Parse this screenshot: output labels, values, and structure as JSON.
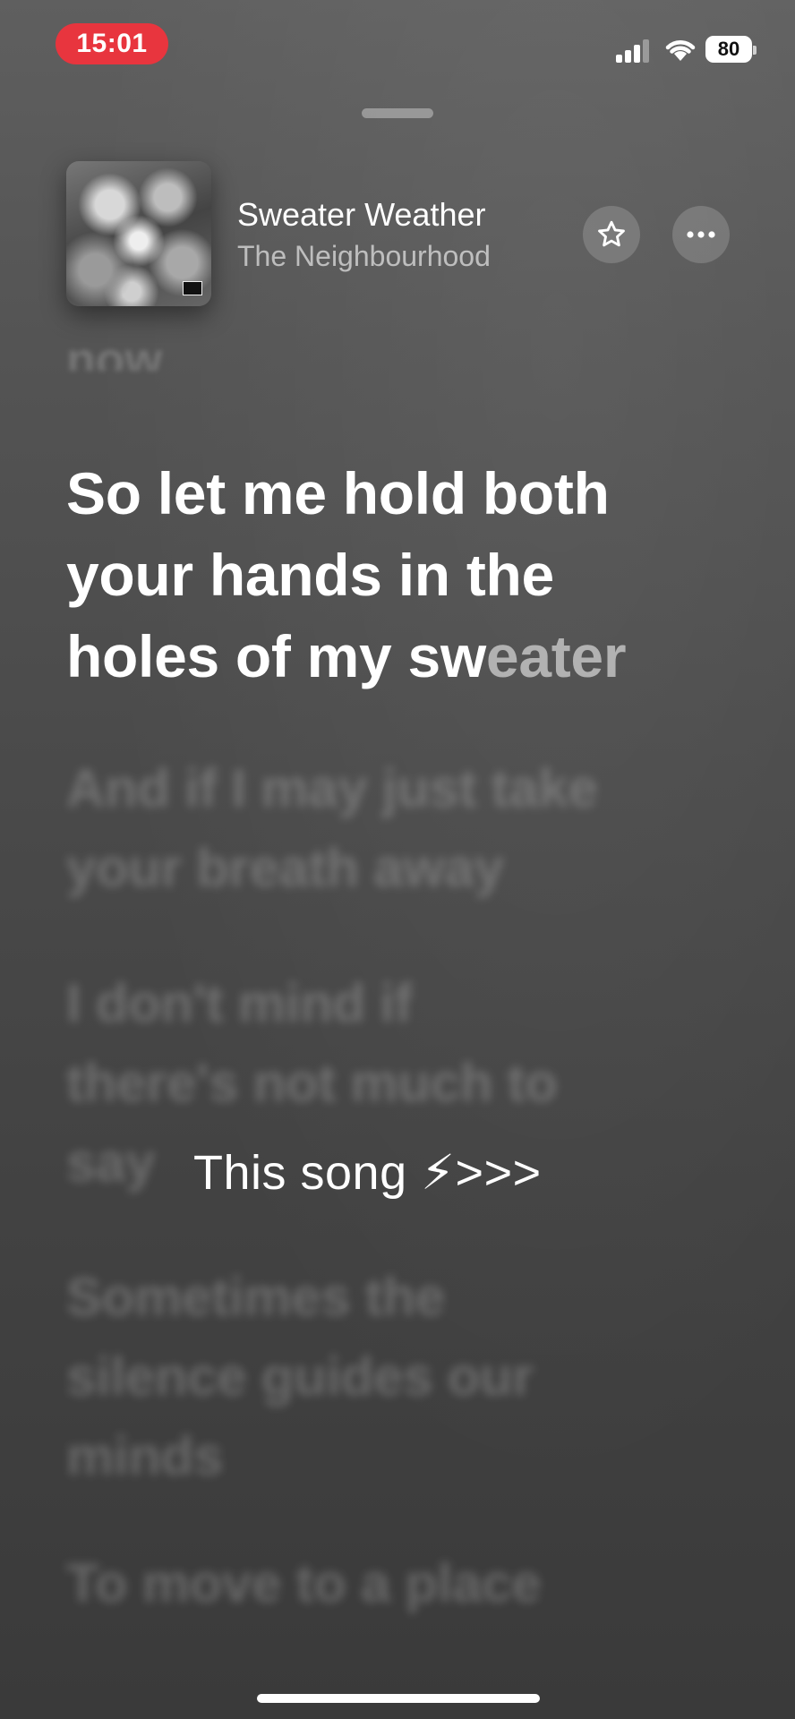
{
  "status_bar": {
    "time": "15:01",
    "battery_level": "80",
    "signal_strength": 3,
    "signal_icon": "cellular-signal-icon",
    "wifi_icon": "wifi-icon",
    "time_pill_color": "#e8353e"
  },
  "now_playing": {
    "title": "Sweater Weather",
    "artist": "The Neighbourhood",
    "favorite_icon": "star-icon",
    "more_icon": "ellipsis-icon"
  },
  "lyrics": {
    "previous_fragment": "now",
    "current_line_sung": "So let me hold both\nyour hands in the\nholes of my sw",
    "current_line_upcoming": "eater",
    "upcoming": [
      "And if I may just take\nyour breath away",
      "I don't mind if\nthere's not much to\nsay",
      "Sometimes the\nsilence guides our\nminds",
      "To move to a place"
    ]
  },
  "caption": {
    "text": "This song ⚡>>>"
  }
}
